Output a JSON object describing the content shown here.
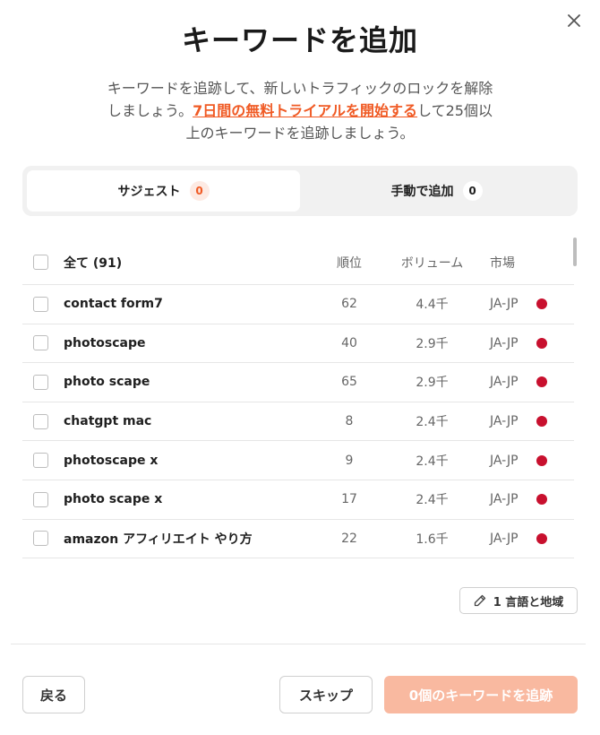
{
  "dialog": {
    "title": "キーワードを追加",
    "description_pre": "キーワードを追跡して、新しいトラフィックのロックを解除しましょう。",
    "description_link": "7日間の無料トライアルを開始する",
    "description_post": "して25個以上のキーワードを追跡しましょう。"
  },
  "tabs": [
    {
      "label": "サジェスト",
      "count": "0",
      "active": true
    },
    {
      "label": "手動で追加",
      "count": "0",
      "active": false
    }
  ],
  "table": {
    "select_all_label": "全て (91)",
    "columns": {
      "rank": "順位",
      "volume": "ボリューム",
      "market": "市場"
    },
    "rows": [
      {
        "keyword": "contact form7",
        "rank": "62",
        "volume": "4.4千",
        "market": "JA-JP"
      },
      {
        "keyword": "photoscape",
        "rank": "40",
        "volume": "2.9千",
        "market": "JA-JP"
      },
      {
        "keyword": "photo scape",
        "rank": "65",
        "volume": "2.9千",
        "market": "JA-JP"
      },
      {
        "keyword": "chatgpt mac",
        "rank": "8",
        "volume": "2.4千",
        "market": "JA-JP"
      },
      {
        "keyword": "photoscape x",
        "rank": "9",
        "volume": "2.4千",
        "market": "JA-JP"
      },
      {
        "keyword": "photo scape x",
        "rank": "17",
        "volume": "2.4千",
        "market": "JA-JP"
      },
      {
        "keyword": "amazon アフィリエイト やり方",
        "rank": "22",
        "volume": "1.6千",
        "market": "JA-JP"
      }
    ]
  },
  "language_button": "1 言語と地域",
  "footer": {
    "back": "戻る",
    "skip": "スキップ",
    "add": "0個のキーワードを追跡"
  },
  "colors": {
    "accent": "#f05a24",
    "add_button": "#f9b9a0",
    "market_dot": "#c8102e"
  }
}
